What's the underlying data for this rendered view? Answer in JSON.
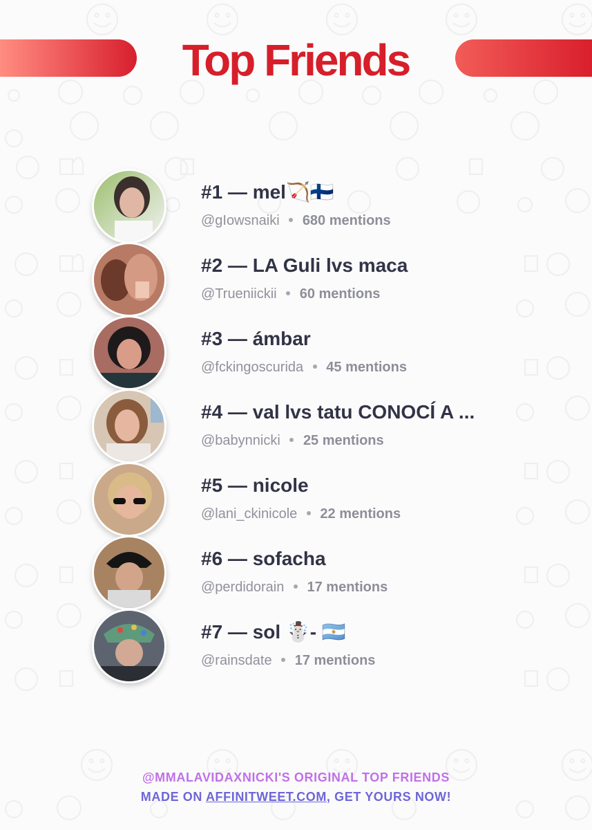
{
  "header": {
    "title": "Top Friends"
  },
  "friends": [
    {
      "rank": "#1",
      "name": "#1 — mel🏹🇫🇮",
      "handle": "@gIowsnaiki",
      "mentions": "680 mentions"
    },
    {
      "rank": "#2",
      "name": "#2 — LA Guli lvs maca",
      "handle": "@Trueniickii",
      "mentions": "60 mentions"
    },
    {
      "rank": "#3",
      "name": "#3 — ámbar",
      "handle": "@fckingoscurida",
      "mentions": "45 mentions"
    },
    {
      "rank": "#4",
      "name": "#4 — val lvs tatu CONOCÍ A ...",
      "handle": "@babynnicki",
      "mentions": "25 mentions"
    },
    {
      "rank": "#5",
      "name": "#5 — nicole",
      "handle": "@lani_ckinicole",
      "mentions": "22 mentions"
    },
    {
      "rank": "#6",
      "name": "#6 — sofacha",
      "handle": "@perdidorain",
      "mentions": "17 mentions"
    },
    {
      "rank": "#7",
      "name": "#7 — sol ☃️- 🇦🇷",
      "handle": "@rainsdate",
      "mentions": "17 mentions"
    }
  ],
  "footer": {
    "line1": "@MMALAVIDAXNICKI'S ORIGINAL TOP FRIENDS",
    "line2_prefix": "MADE ON ",
    "line2_link": "AFFINITWEET.COM",
    "line2_suffix": ", GET YOURS NOW!"
  },
  "colors": {
    "title_red": "#d61f2a",
    "header_bar": "#e33a3f",
    "footer_purple": "#c070e8",
    "footer_blue": "#6e66d8"
  },
  "icons": {
    "background_pattern": "emoji-pattern-icon"
  }
}
